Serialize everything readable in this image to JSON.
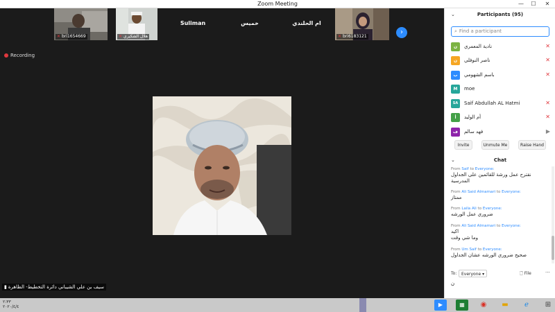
{
  "window": {
    "title": "Zoom Meeting",
    "minimize": "—",
    "maximize": "☐",
    "close": "✕"
  },
  "thumbnails": [
    {
      "name": "bri1654669"
    },
    {
      "name": "هلال الشكيري"
    },
    {
      "name": "Suliman"
    },
    {
      "name": "خميس"
    },
    {
      "name": "ام الحلندي"
    },
    {
      "name": "bri6183121"
    }
  ],
  "recording": "Recording",
  "speaker_name": "سيف بن علي الشيباني دائرة التخطيط- الظاهرة",
  "panel": {
    "participants_title": "Participants (95)",
    "search_placeholder": "Find a participant",
    "participants": [
      {
        "initial": "ن",
        "name": "نادية المعمري",
        "color": "#7cb342",
        "status": "muted"
      },
      {
        "initial": "ن",
        "name": "ناصر النوفلي",
        "color": "#f5a623",
        "status": "muted"
      },
      {
        "initial": "ب",
        "name": "باسم الشهومي",
        "color": "#2d8cff",
        "status": "muted"
      },
      {
        "initial": "M",
        "name": "moe",
        "color": "#26a69a",
        "status": "none"
      },
      {
        "initial": "SA",
        "name": "Saif Abdullah AL Hatmi",
        "color": "#26a69a",
        "status": "muted"
      },
      {
        "initial": "أ",
        "name": "أم الوليد",
        "color": "#43a047",
        "status": "muted"
      },
      {
        "initial": "ف",
        "name": "فهد سالم",
        "color": "#8e24aa",
        "status": "video"
      }
    ],
    "buttons": {
      "invite": "Invite",
      "unmute": "Unmute Me",
      "raise": "Raise Hand"
    },
    "chat_title": "Chat",
    "messages": [
      {
        "prefix": "From ",
        "from": "Saif",
        "mid": " to ",
        "to": "Everyone:",
        "text": "نقترح عمل ورشة للقائمين على الجداول المدرسية"
      },
      {
        "prefix": "From ",
        "from": "Ali Said Almamari",
        "mid": " to ",
        "to": "Everyone:",
        "text": "ممتاز"
      },
      {
        "prefix": "From ",
        "from": "Laila Ali",
        "mid": " to ",
        "to": "Everyone:",
        "text": "ضروري عمل الورشه"
      },
      {
        "prefix": "From ",
        "from": "Ali Said Almamari",
        "mid": " to ",
        "to": "Everyone:",
        "text": "اكيد\nوما شي وقت"
      },
      {
        "prefix": "From ",
        "from": "Um Saif",
        "mid": " to ",
        "to": "Everyone:",
        "text": "صحيح ضروري الورشه عشان الجداول"
      }
    ],
    "to_label": "To:",
    "to_value": "Everyone",
    "file_label": "File",
    "more": "···",
    "chat_input": "ن"
  },
  "taskbar": {
    "time": "٢:٣٣",
    "date": "٢٠٢٠/٤/٤"
  },
  "colors": {
    "accent": "#2d8cff",
    "muted_red": "#e0383e"
  }
}
